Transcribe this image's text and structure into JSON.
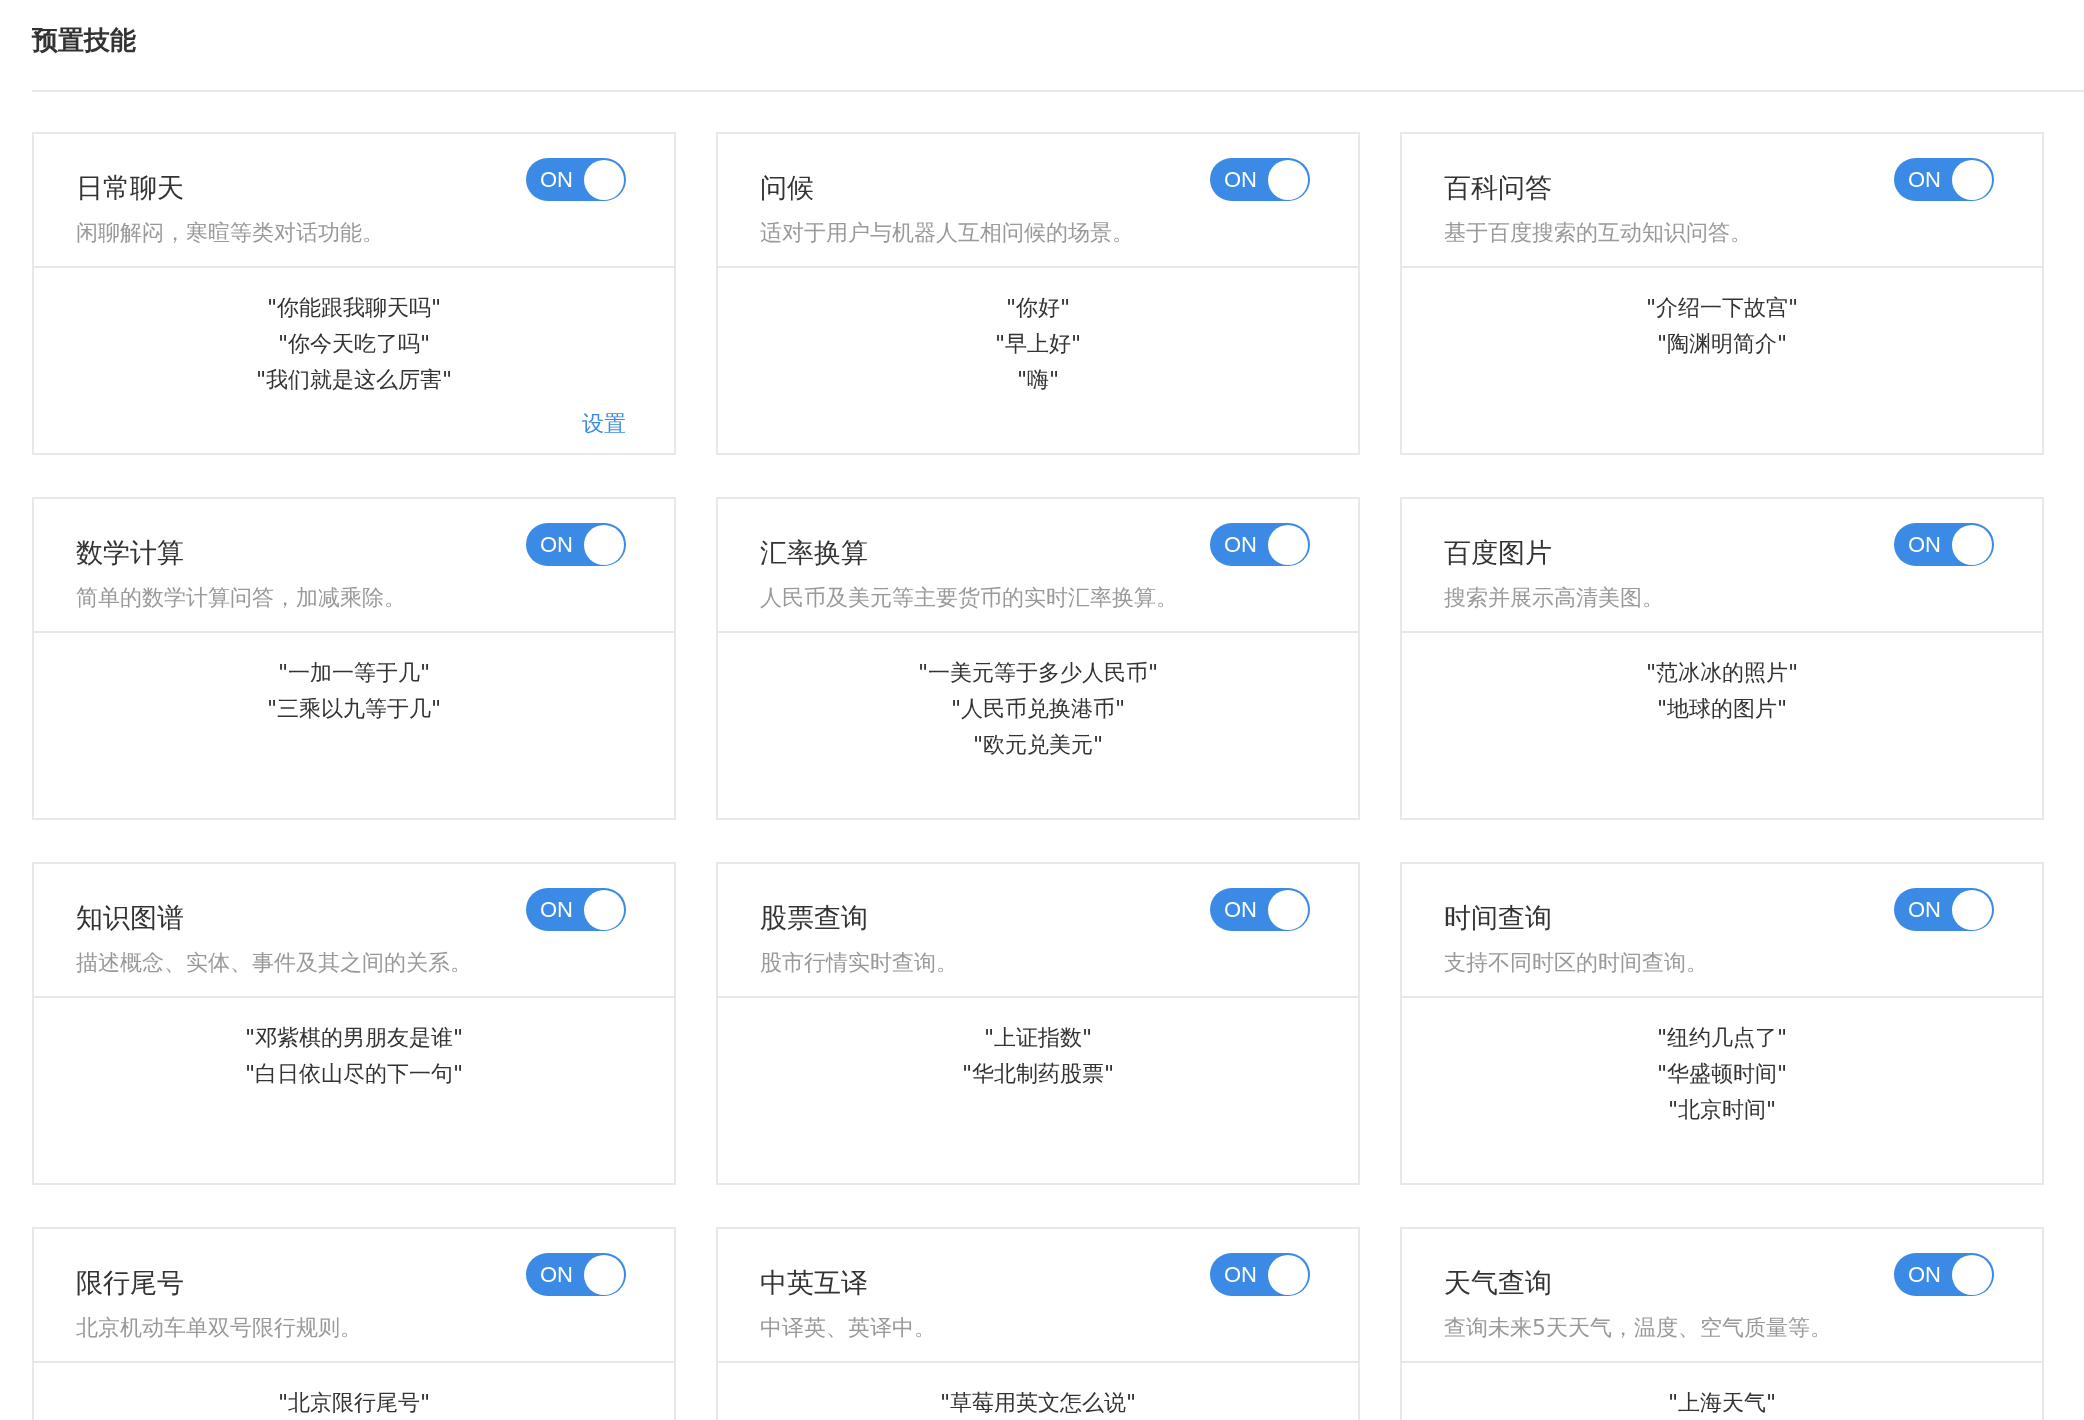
{
  "section_title": "预置技能",
  "skills": [
    {
      "title": "日常聊天",
      "toggle": {
        "label": "ON",
        "on": true
      },
      "description": "闲聊解闷，寒暄等类对话功能。",
      "examples": [
        "\"你能跟我聊天吗\"",
        "\"你今天吃了吗\"",
        "\"我们就是这么厉害\""
      ],
      "link": "设置"
    },
    {
      "title": "问候",
      "toggle": {
        "label": "ON",
        "on": true
      },
      "description": "适对于用户与机器人互相问候的场景。",
      "examples": [
        "\"你好\"",
        "\"早上好\"",
        "\"嗨\""
      ]
    },
    {
      "title": "百科问答",
      "toggle": {
        "label": "ON",
        "on": true
      },
      "description": "基于百度搜索的互动知识问答。",
      "examples": [
        "\"介绍一下故宫\"",
        "\"陶渊明简介\""
      ]
    },
    {
      "title": "数学计算",
      "toggle": {
        "label": "ON",
        "on": true
      },
      "description": "简单的数学计算问答，加减乘除。",
      "examples": [
        "\"一加一等于几\"",
        "\"三乘以九等于几\""
      ]
    },
    {
      "title": "汇率换算",
      "toggle": {
        "label": "ON",
        "on": true
      },
      "description": "人民币及美元等主要货币的实时汇率换算。",
      "examples": [
        "\"一美元等于多少人民币\"",
        "\"人民币兑换港币\"",
        "\"欧元兑美元\""
      ]
    },
    {
      "title": "百度图片",
      "toggle": {
        "label": "ON",
        "on": true
      },
      "description": "搜索并展示高清美图。",
      "examples": [
        "\"范冰冰的照片\"",
        "\"地球的图片\""
      ]
    },
    {
      "title": "知识图谱",
      "toggle": {
        "label": "ON",
        "on": true
      },
      "description": "描述概念、实体、事件及其之间的关系。",
      "examples": [
        "\"邓紫棋的男朋友是谁\"",
        "\"白日依山尽的下一句\""
      ]
    },
    {
      "title": "股票查询",
      "toggle": {
        "label": "ON",
        "on": true
      },
      "description": "股市行情实时查询。",
      "examples": [
        "\"上证指数\"",
        "\"华北制药股票\""
      ]
    },
    {
      "title": "时间查询",
      "toggle": {
        "label": "ON",
        "on": true
      },
      "description": "支持不同时区的时间查询。",
      "examples": [
        "\"纽约几点了\"",
        "\"华盛顿时间\"",
        "\"北京时间\""
      ]
    },
    {
      "title": "限行尾号",
      "toggle": {
        "label": "ON",
        "on": true
      },
      "description": "北京机动车单双号限行规则。",
      "examples": [
        "\"北京限行尾号\""
      ]
    },
    {
      "title": "中英互译",
      "toggle": {
        "label": "ON",
        "on": true
      },
      "description": "中译英、英译中。",
      "examples": [
        "\"草莓用英文怎么说\""
      ]
    },
    {
      "title": "天气查询",
      "toggle": {
        "label": "ON",
        "on": true
      },
      "description": "查询未来5天天气，温度、空气质量等。",
      "examples": [
        "\"上海天气\""
      ]
    }
  ]
}
